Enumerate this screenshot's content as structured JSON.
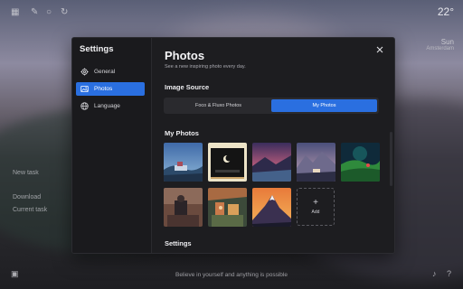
{
  "background": {
    "weather_temp": "22°",
    "weather_location": "Sun",
    "weather_detail": "Amsterdam",
    "bottom_message": "Believe in yourself and anything is possible",
    "left_item_1": "New task",
    "left_item_2": "Download",
    "left_item_3": "Current task"
  },
  "settings_modal": {
    "sidebar": {
      "title": "Settings",
      "items": [
        {
          "label": "General",
          "icon": "gear-icon",
          "active": false
        },
        {
          "label": "Photos",
          "icon": "image-icon",
          "active": true
        },
        {
          "label": "Language",
          "icon": "globe-icon",
          "active": false
        }
      ]
    },
    "content": {
      "title": "Photos",
      "subtitle": "See a new inspiring photo every day.",
      "image_source_heading": "Image Source",
      "source_options": [
        {
          "label": "Foco & Fluxo Photos",
          "active": false
        },
        {
          "label": "My Photos",
          "active": true
        }
      ],
      "my_photos_heading": "My Photos",
      "add_label": "Add",
      "settings_heading": "Settings"
    }
  },
  "colors": {
    "accent": "#2a6fe0",
    "modal_bg": "#1d1d20",
    "sidebar_bg": "#1a1a1d"
  }
}
